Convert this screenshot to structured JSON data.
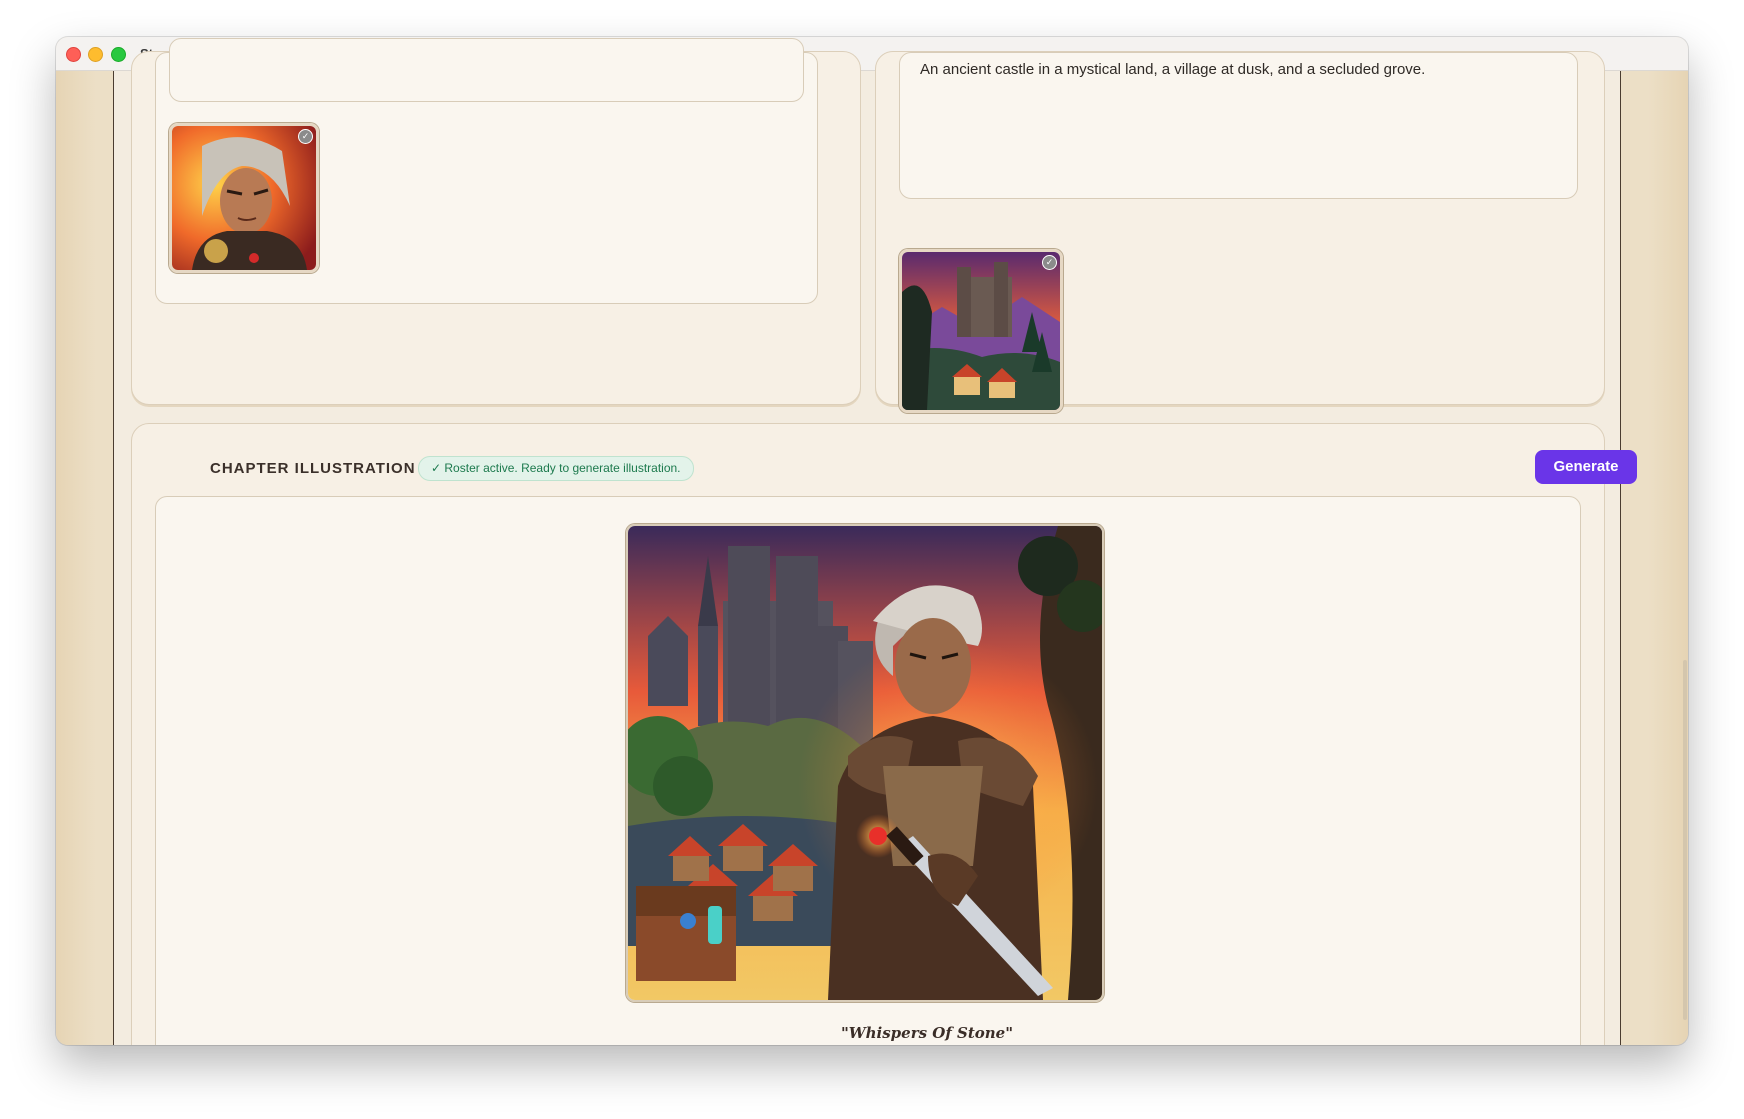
{
  "app": {
    "title": "StoryMaker AI"
  },
  "characters": {
    "thumbnail": {
      "icon": "check-icon"
    }
  },
  "settings": {
    "description": "An ancient castle in a mystical land, a village at dusk, and a secluded grove.",
    "thumbnail": {
      "icon": "check-icon"
    }
  },
  "chapter": {
    "title": "CHAPTER ILLUSTRATION",
    "status": "✓ Roster active. Ready to generate illustration.",
    "generate_label": "Generate",
    "caption": "\"Whispers Of Stone\""
  },
  "colors": {
    "accent": "#6a35e8",
    "status_green": "#1d7a4e",
    "paper": "#f3ece0"
  }
}
